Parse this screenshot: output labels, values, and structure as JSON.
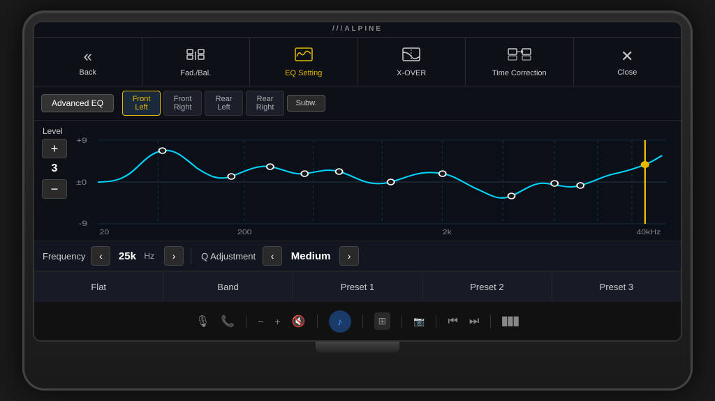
{
  "brand": {
    "logo": "///ALPINE"
  },
  "nav": {
    "back": "Back",
    "fad_bal": "Fad./Bal.",
    "eq_setting": "EQ Setting",
    "xover": "X-OVER",
    "time_correction": "Time Correction",
    "close": "Close"
  },
  "channels": {
    "adv_eq": "Advanced EQ",
    "front_left": "Front\nLeft",
    "front_right": "Front\nRight",
    "rear_left": "Rear\nLeft",
    "rear_right": "Rear\nRight",
    "subw": "Subw."
  },
  "level": {
    "label": "Level",
    "plus": "+",
    "minus": "−",
    "value": "3"
  },
  "graph": {
    "y_max": "+9",
    "y_mid": "±0",
    "y_min": "-9",
    "x_labels": [
      "20",
      "200",
      "2k",
      "40kHz"
    ]
  },
  "frequency": {
    "label": "Frequency",
    "value": "25k",
    "unit": "Hz",
    "left_arrow": "‹",
    "right_arrow": "›"
  },
  "q_adjustment": {
    "label": "Q Adjustment",
    "value": "Medium",
    "left_arrow": "‹",
    "right_arrow": "›"
  },
  "presets": {
    "flat": "Flat",
    "band": "Band",
    "preset1": "Preset 1",
    "preset2": "Preset 2",
    "preset3": "Preset 3"
  },
  "bottom_bar": {
    "mic": "🎤",
    "phone": "📞",
    "minus": "−",
    "plus": "+",
    "mute": "🔇",
    "music": "♪",
    "grid": "⊞",
    "camera": "📷",
    "prev": "⏮",
    "next": "⏭",
    "signal": "▊▊"
  },
  "colors": {
    "active_gold": "#e6b800",
    "eq_line": "#00d4ff",
    "selected_line": "#e6b800",
    "bg_dark": "#0d1117"
  }
}
